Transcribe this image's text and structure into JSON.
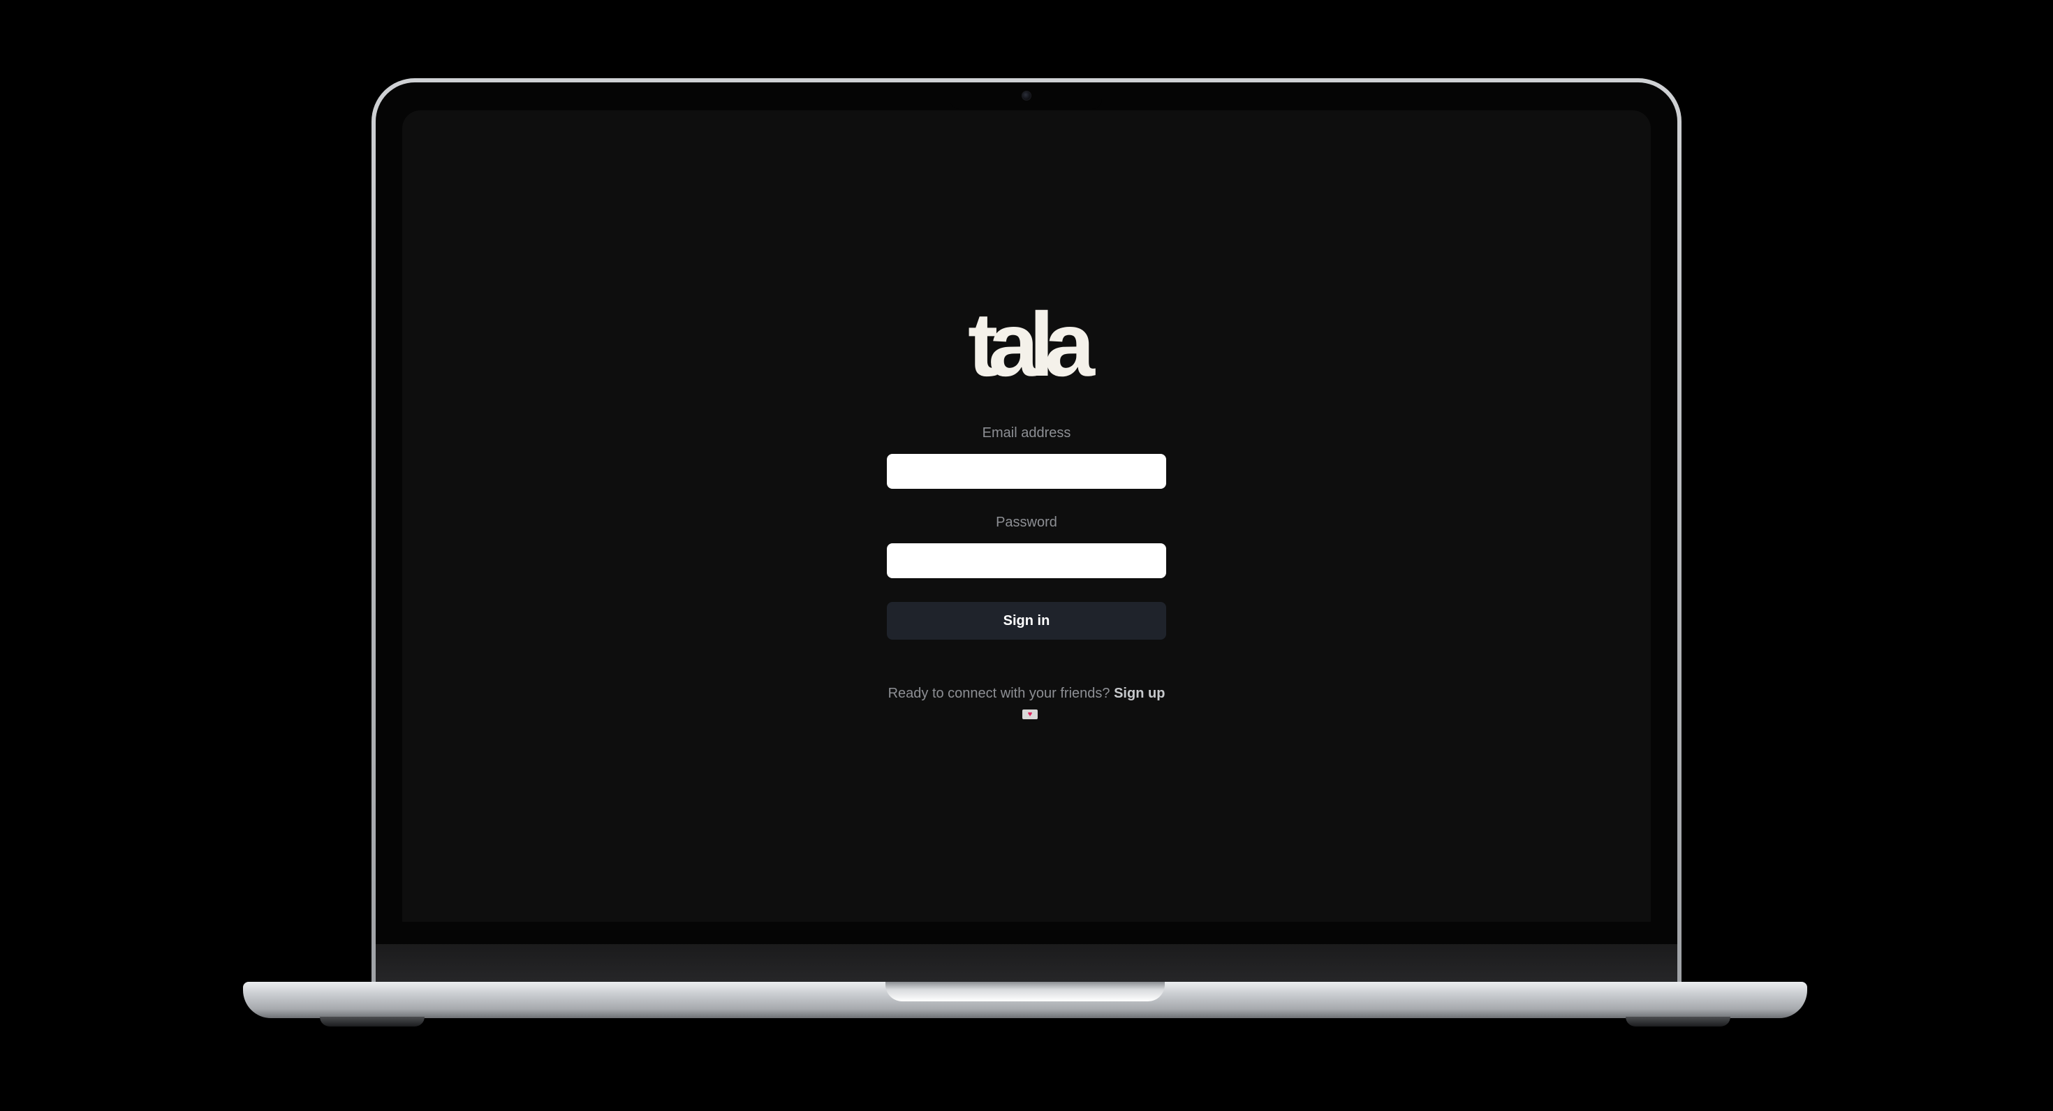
{
  "app": {
    "logo_text": "tala"
  },
  "login": {
    "email_label": "Email address",
    "email_value": "",
    "password_label": "Password",
    "password_value": "",
    "signin_label": "Sign in",
    "signup_prompt": "Ready to connect with your friends?",
    "signup_link": "Sign up",
    "heart_icon": "heart-flag-icon"
  },
  "colors": {
    "page_background": "#000000",
    "screen_background": "#0e0e0e",
    "button_background": "#1f232b",
    "label_text": "#8d8f94",
    "logo": "#f4f1ea"
  }
}
